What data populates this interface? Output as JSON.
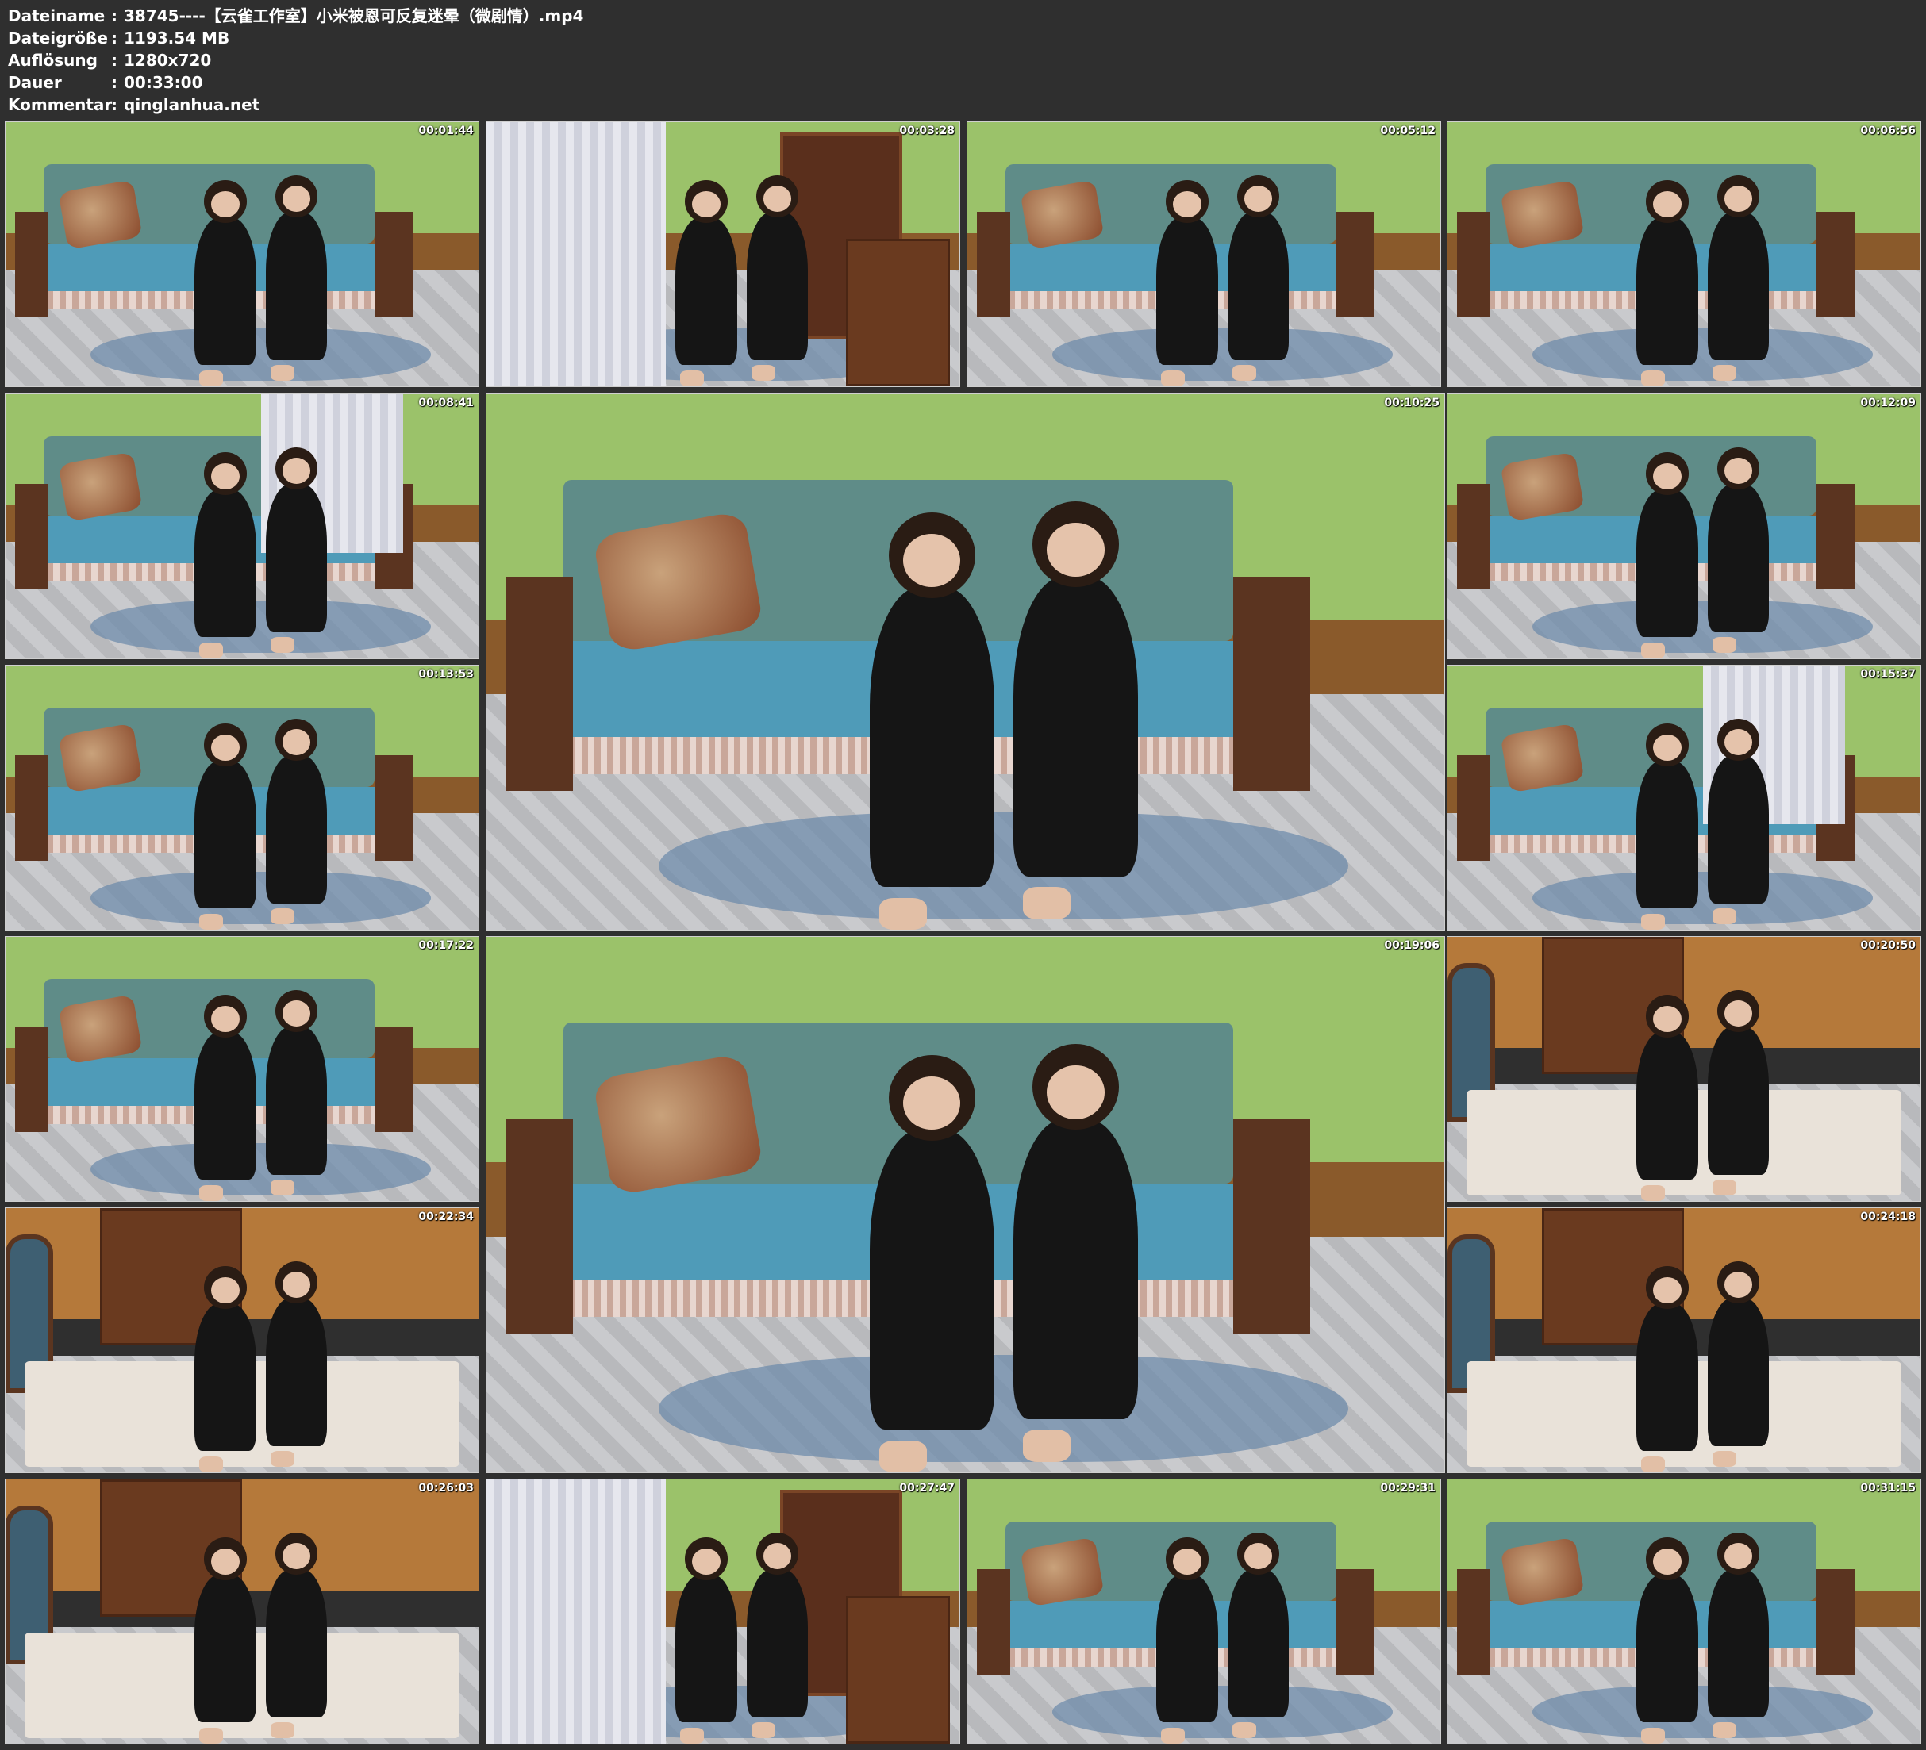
{
  "metadata": [
    {
      "label": "Dateiname",
      "value": "38745----【云雀工作室】小米被恩可反复迷晕（微剧情）.mp4"
    },
    {
      "label": "Dateigröße",
      "value": "1193.54 MB"
    },
    {
      "label": "Auflösung",
      "value": "1280x720"
    },
    {
      "label": "Dauer",
      "value": "00:33:00"
    },
    {
      "label": "Kommentar",
      "value": "qinglanhua.net"
    }
  ],
  "separator": ":",
  "thumbnails": [
    {
      "timestamp": "00:01:44"
    },
    {
      "timestamp": "00:03:28"
    },
    {
      "timestamp": "00:05:12"
    },
    {
      "timestamp": "00:06:56"
    },
    {
      "timestamp": "00:08:41"
    },
    {
      "timestamp": "00:10:25"
    },
    {
      "timestamp": "00:12:09"
    },
    {
      "timestamp": "00:13:53"
    },
    {
      "timestamp": "00:15:37"
    },
    {
      "timestamp": "00:17:22"
    },
    {
      "timestamp": "00:19:06"
    },
    {
      "timestamp": "00:20:50"
    },
    {
      "timestamp": "00:22:34"
    },
    {
      "timestamp": "00:24:18"
    },
    {
      "timestamp": "00:26:03"
    },
    {
      "timestamp": "00:27:47"
    },
    {
      "timestamp": "00:29:31"
    },
    {
      "timestamp": "00:31:15"
    }
  ]
}
